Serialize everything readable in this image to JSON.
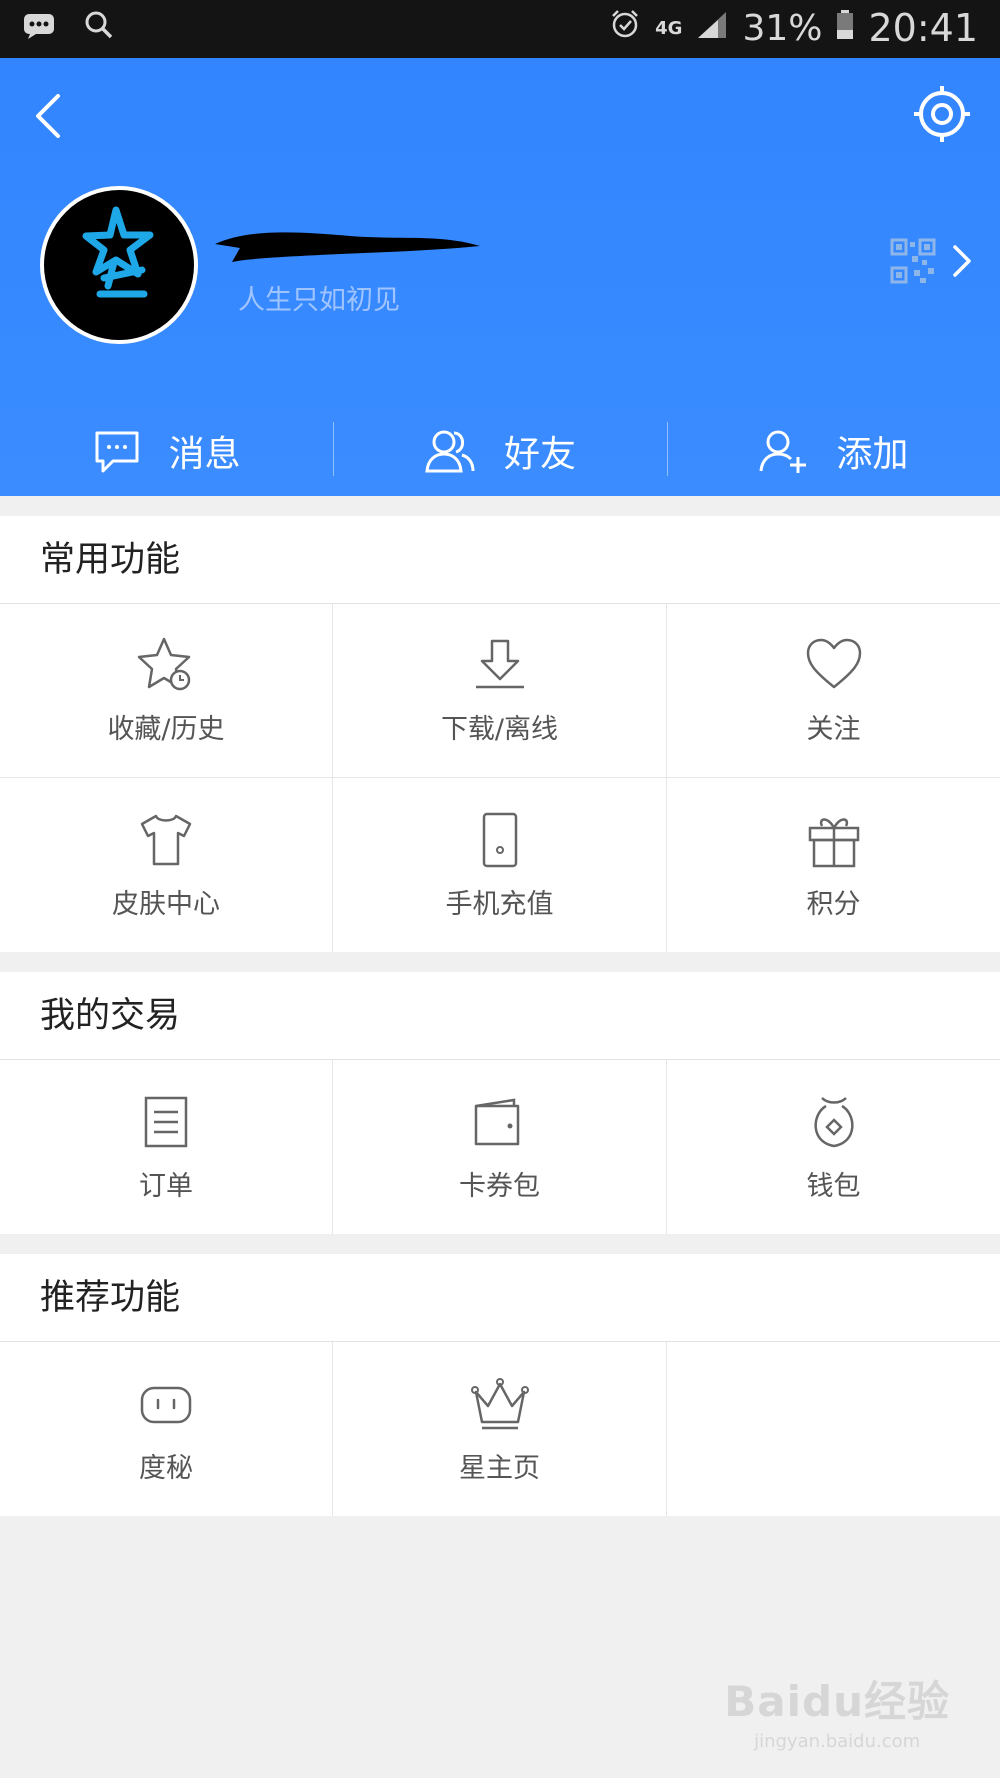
{
  "status_bar": {
    "network": "4G",
    "battery": "31%",
    "time": "20:41",
    "icons": [
      "message-icon",
      "search-icon",
      "alarm-icon",
      "signal-icon",
      "battery-icon"
    ]
  },
  "header": {
    "signature": "人生只如初见",
    "accent_color": "#3385ff"
  },
  "quick_actions": [
    {
      "label": "消息",
      "icon": "message-bubble-icon"
    },
    {
      "label": "好友",
      "icon": "friends-icon"
    },
    {
      "label": "添加",
      "icon": "add-user-icon"
    }
  ],
  "sections": {
    "common": {
      "title": "常用功能",
      "items": [
        {
          "label": "收藏/历史",
          "icon": "star-clock-icon"
        },
        {
          "label": "下载/离线",
          "icon": "download-icon"
        },
        {
          "label": "关注",
          "icon": "heart-icon"
        },
        {
          "label": "皮肤中心",
          "icon": "tshirt-icon"
        },
        {
          "label": "手机充值",
          "icon": "phone-icon"
        },
        {
          "label": "积分",
          "icon": "gift-icon"
        }
      ]
    },
    "trade": {
      "title": "我的交易",
      "items": [
        {
          "label": "订单",
          "icon": "order-list-icon"
        },
        {
          "label": "卡券包",
          "icon": "wallet-card-icon"
        },
        {
          "label": "钱包",
          "icon": "money-bag-icon"
        }
      ]
    },
    "recommend": {
      "title": "推荐功能",
      "items": [
        {
          "label": "度秘",
          "icon": "robot-face-icon"
        },
        {
          "label": "星主页",
          "icon": "crown-icon"
        }
      ]
    }
  },
  "watermark": {
    "main": "Baidu经验",
    "sub": "jingyan.baidu.com"
  }
}
